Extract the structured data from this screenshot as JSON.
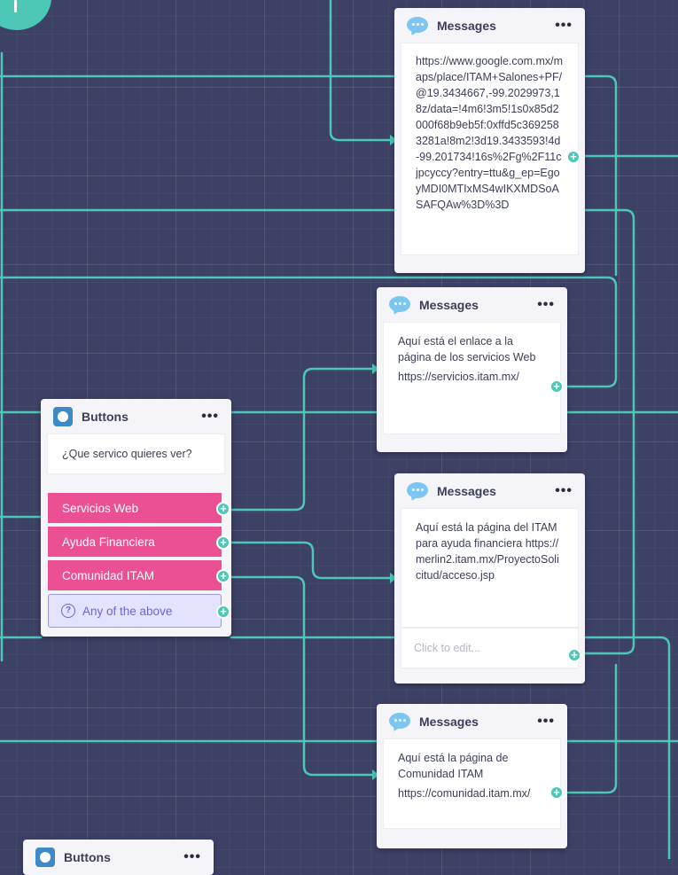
{
  "nodes": {
    "msg1": {
      "title": "Messages",
      "menu": "•••",
      "text": "https://www.google.com.mx/maps/place/ITAM+Salones+PF/@19.3434667,-99.2029973,18z/data=!4m6!3m5!1s0x85d2000f68b9eb5f:0xffd5c3692583281a!8m2!3d19.3433593!4d-99.201734!16s%2Fg%2F11cjpcyccy?entry=ttu&g_ep=EgoyMDI0MTIxMS4wIKXMDSoASAFQAw%3D%3D"
    },
    "msg2": {
      "title": "Messages",
      "menu": "•••",
      "text": "Aquí está el enlace a la página de los servicios Web",
      "url": "https://servicios.itam.mx/"
    },
    "msg3": {
      "title": "Messages",
      "menu": "•••",
      "text": "Aquí está la página del ITAM para ayuda financiera https://merlin2.itam.mx/ProyectoSolicitud/acceso.jsp",
      "placeholder": "Click to edit..."
    },
    "msg4": {
      "title": "Messages",
      "menu": "•••",
      "text": "Aquí está la página de Comunidad ITAM",
      "url": "https://comunidad.itam.mx/"
    },
    "buttons1": {
      "title": "Buttons",
      "menu": "•••",
      "question": "¿Que servico quieres ver?",
      "options": [
        "Servicios Web",
        "Ayuda Financiera",
        "Comunidad ITAM"
      ],
      "any_option": "Any of the above"
    },
    "buttons2": {
      "title": "Buttons",
      "menu": "•••"
    }
  },
  "icons": {
    "message": "chat-bubble-icon",
    "buttons": "buttons-block-icon",
    "plus": "plus-icon",
    "help": "question-circle-icon"
  },
  "colors": {
    "canvas": "#3d4166",
    "connector": "#4cc7b8",
    "choice": "#ea5093",
    "any_option_bg": "#e3e2ff",
    "any_option_text": "#6b66d6",
    "node_bg": "#f4f4f9"
  },
  "plus_symbol": "+",
  "help_symbol": "?"
}
